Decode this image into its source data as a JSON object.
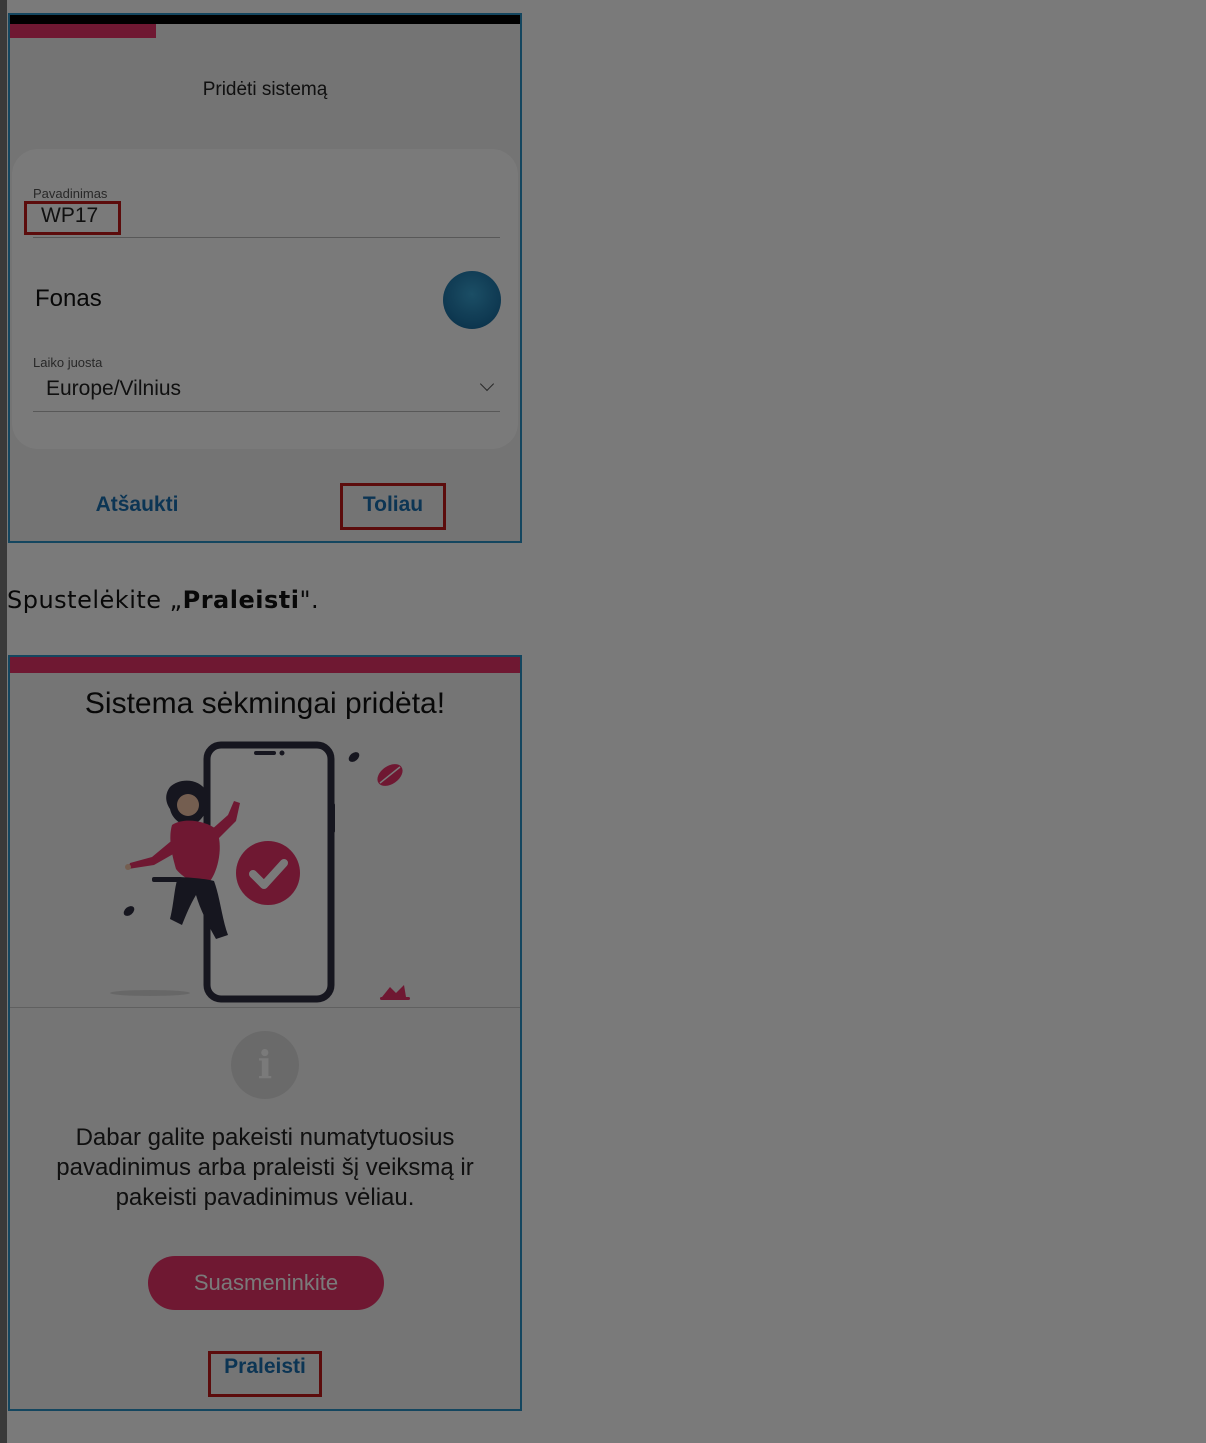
{
  "screen1": {
    "title": "Pridėti sistemą",
    "name_field": {
      "label": "Pavadinimas",
      "value": "WP17"
    },
    "background_label": "Fonas",
    "timezone_field": {
      "label": "Laiko juosta",
      "value": "Europe/Vilnius"
    },
    "cancel_label": "Atšaukti",
    "next_label": "Toliau"
  },
  "instruction": {
    "prefix": "Spustelėkite „",
    "bold": "Praleisti",
    "suffix": "\"."
  },
  "screen2": {
    "title": "Sistema sėkmingai pridėta!",
    "info_icon_glyph": "i",
    "message": "Dabar galite pakeisti numatytuosius pavadinimus arba praleisti šį veiksmą ir pakeisti pavadinimus vėliau.",
    "customize_label": "Suasmeninkite",
    "skip_label": "Praleisti"
  },
  "colors": {
    "accent": "#e8326a",
    "link": "#1a6fb0",
    "highlight": "#c11a1a",
    "frame": "#2a93c7"
  },
  "icons": [
    "chevron-down-icon",
    "info-icon",
    "check-circle-icon"
  ]
}
